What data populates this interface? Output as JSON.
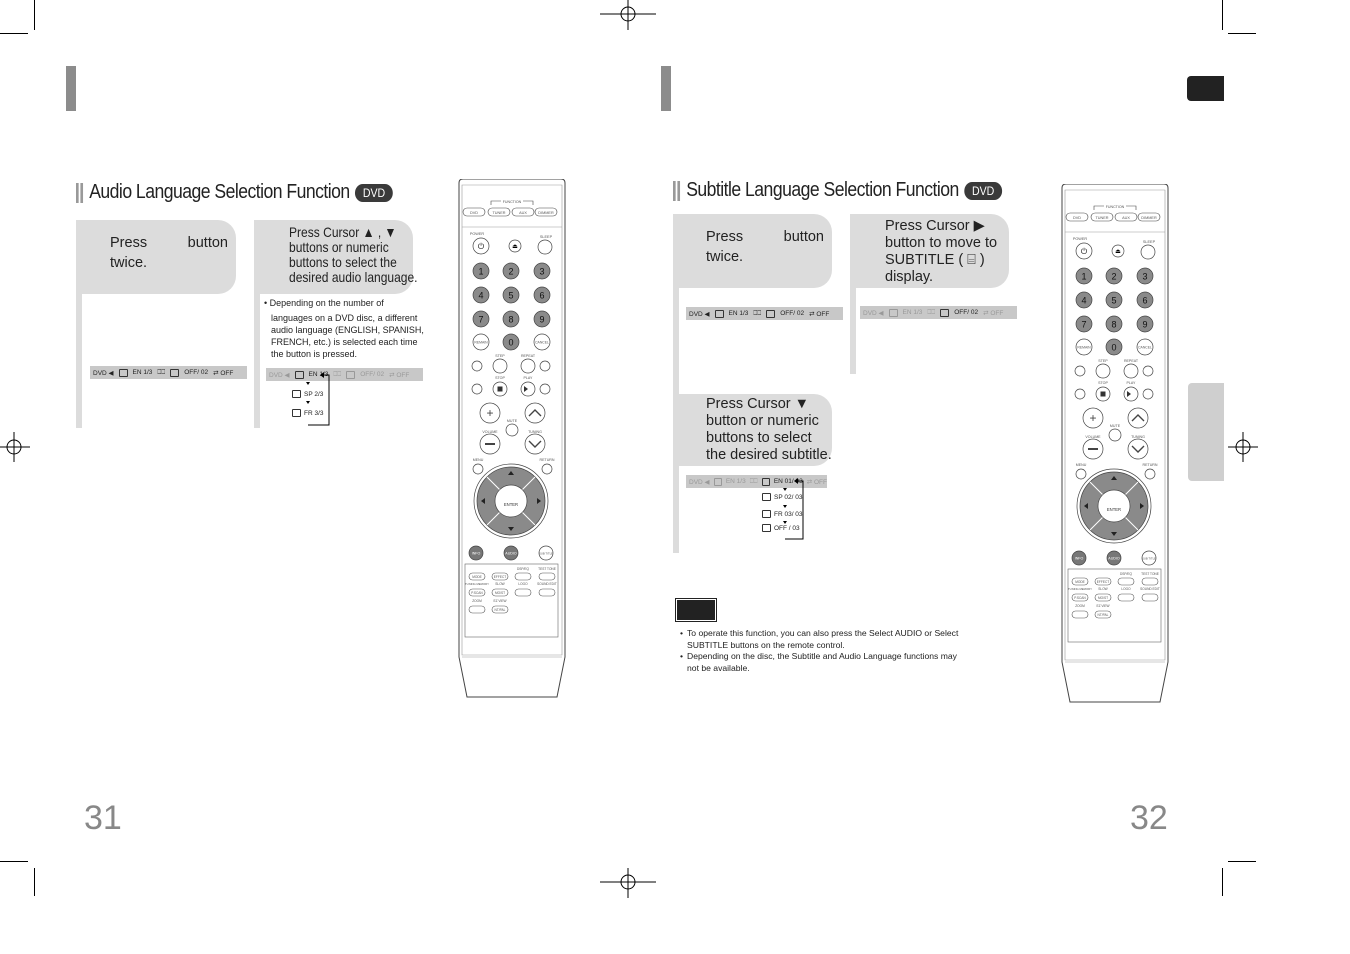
{
  "left_page": {
    "page_number": "31",
    "section_title": "Audio Language Selection Function",
    "badge": "DVD",
    "step1": {
      "press": "Press",
      "button": "button",
      "twice": "twice."
    },
    "step2": {
      "line1": "Press Cursor ▲ , ▼",
      "line2": "buttons or numeric",
      "line3": "buttons to select the",
      "line4": "desired audio language."
    },
    "note_bullet": "Depending on the number of",
    "note_rest": "languages on a DVD disc, a different audio language (ENGLISH, SPANISH, FRENCH, etc.) is selected each time the button is pressed.",
    "osd": {
      "dvd": "DVD ◀",
      "audio": "EN 1/3",
      "angle": "⎕⎕",
      "subtitle": "OFF/ 02",
      "repeat": "⇄ OFF"
    },
    "audio_options": [
      "SP 2/3",
      "FR 3/3"
    ]
  },
  "right_page": {
    "page_number": "32",
    "section_title": "Subtitle Language Selection Function",
    "badge": "DVD",
    "step1": {
      "press": "Press",
      "button": "button",
      "twice": "twice."
    },
    "step2": {
      "line1": "Press Cursor ▶",
      "line2": "button to move to",
      "line3": "SUBTITLE ( ⌸ )",
      "line4": "display."
    },
    "step3": {
      "line1": "Press Cursor ▼",
      "line2": "button or numeric",
      "line3": "buttons to select",
      "line4": "the desired subtitle."
    },
    "osd": {
      "dvd": "DVD ◀",
      "audio": "EN 1/3",
      "angle": "⎕⎕",
      "subtitle": "OFF/ 02",
      "repeat": "⇄ OFF",
      "subtitle_sel": "EN 01/ 03"
    },
    "subtitle_options": [
      "SP 02/ 03",
      "FR 03/ 03",
      "OFF / 03"
    ],
    "notes": [
      "To operate this function, you can also press the Select AUDIO or Select SUBTITLE buttons on the remote control.",
      "Depending on the disc, the Subtitle and Audio Language functions may not be available."
    ]
  },
  "remote": {
    "function_label": "FUNCTION",
    "function_buttons": [
      "DVD",
      "TUNER",
      "AUX",
      "DIMMER"
    ],
    "power": "POWER",
    "sleep": "SLEEP",
    "numbers": [
      "1",
      "2",
      "3",
      "4",
      "5",
      "6",
      "7",
      "8",
      "9",
      "0"
    ],
    "remain": "REMAIN",
    "cancel": "CANCEL",
    "step": "STEP",
    "repeat": "REPEAT",
    "stop": "STOP",
    "play": "PLAY",
    "mute": "MUTE",
    "volume": "VOLUME",
    "tuning": "TUNING",
    "menu": "MENU",
    "return": "RETURN",
    "enter": "ENTER",
    "info": "INFO",
    "audio": "AUDIO",
    "subtitle": "SUB TITLE",
    "dsp": "DSP/EQ",
    "test_tone": "TEST TONE",
    "mode": "MODE",
    "effect": "EFFECT",
    "tuning_memory": "TUNING MEMORY",
    "pscan": "P.SCAN",
    "slow": "SLOW",
    "mo_st": "MO/ST",
    "logo": "LOGO",
    "sound_edit": "SOUND EDIT",
    "zoom": "ZOOM",
    "ez_view": "EZ VIEW",
    "ntpal": "NT/PAL"
  },
  "colors": {
    "panel": "#dcdcdc",
    "badge": "#3a3a3a",
    "number_button": "#8a8a8a",
    "accent_bar": "#8c8c8c"
  }
}
